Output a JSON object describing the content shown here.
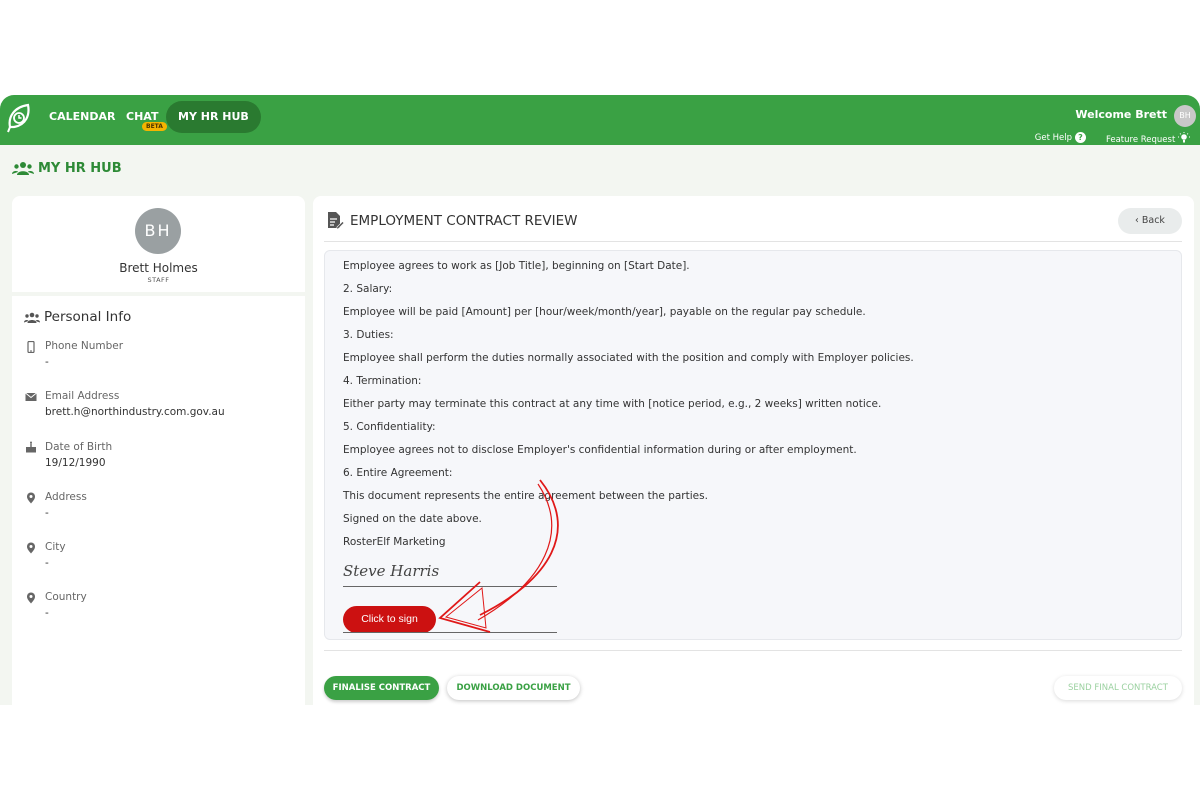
{
  "topbar": {
    "nav": [
      "CALENDAR",
      "CHAT",
      "MY HR HUB"
    ],
    "beta_badge": "BETA",
    "welcome": "Welcome Brett",
    "avatar_initials": "BH",
    "get_help": "Get Help",
    "feature_request": "Feature Request",
    "brand_color": "#3aa144"
  },
  "page_title": "MY HR HUB",
  "profile": {
    "initials": "BH",
    "name": "Brett Holmes",
    "role": "STAFF"
  },
  "personal_info": {
    "title": "Personal Info",
    "fields": [
      {
        "label": "Phone Number",
        "value": "-",
        "icon": "phone-icon"
      },
      {
        "label": "Email Address",
        "value": "brett.h@northindustry.com.gov.au",
        "icon": "email-icon"
      },
      {
        "label": "Date of Birth",
        "value": "19/12/1990",
        "icon": "cake-icon"
      },
      {
        "label": "Address",
        "value": "-",
        "icon": "location-pin-icon"
      },
      {
        "label": "City",
        "value": "-",
        "icon": "location-pin-icon"
      },
      {
        "label": "Country",
        "value": "-",
        "icon": "location-pin-icon"
      }
    ]
  },
  "contract": {
    "title": "EMPLOYMENT CONTRACT REVIEW",
    "back_label": "Back",
    "lines": [
      "Employee agrees to work as [Job Title], beginning on [Start Date].",
      "2. Salary:",
      "Employee will be paid [Amount] per [hour/week/month/year], payable on the regular pay schedule.",
      "3. Duties:",
      "Employee shall perform the duties normally associated with the position and comply with Employer policies.",
      "4. Termination:",
      "Either party may terminate this contract at any time with [notice period, e.g., 2 weeks] written notice.",
      "5. Confidentiality:",
      "Employee agrees not to disclose Employer's confidential information during or after employment.",
      "6. Entire Agreement:",
      "This document represents the entire agreement between the parties.",
      "Signed on the date above.",
      "RosterElf Marketing"
    ],
    "signature": "Steve Harris",
    "sign_button": "Click to sign"
  },
  "actions": {
    "finalise": "FINALISE CONTRACT",
    "download": "DOWNLOAD DOCUMENT",
    "send_final": "SEND FINAL CONTRACT"
  }
}
